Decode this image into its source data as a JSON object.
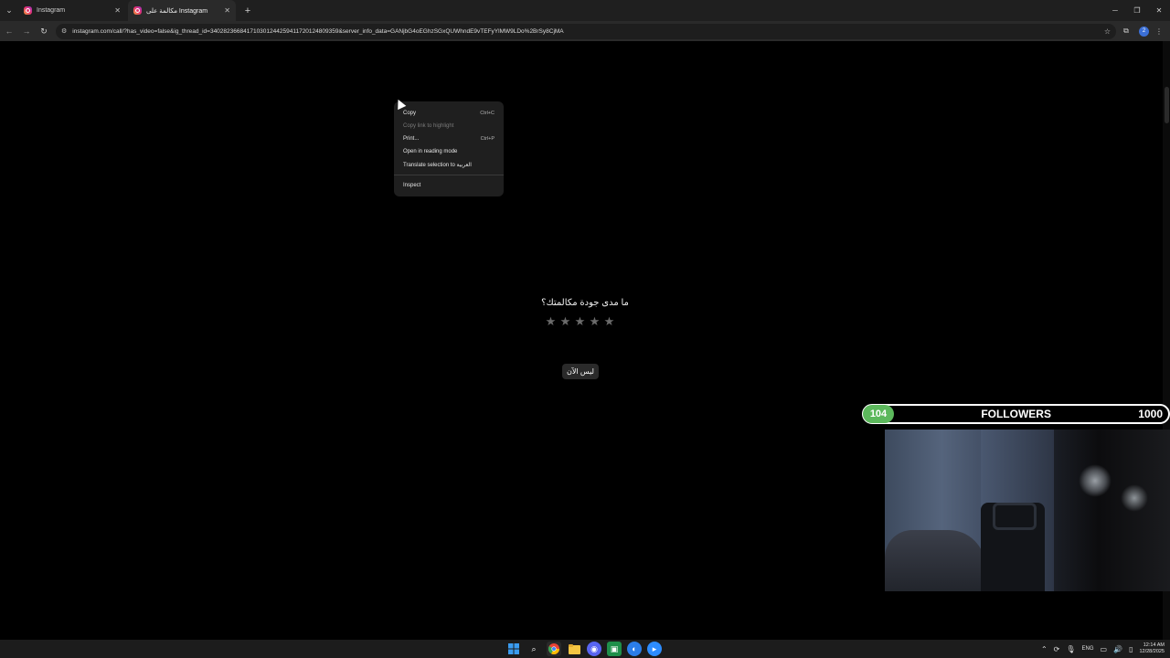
{
  "browser": {
    "tabs": [
      {
        "title": "Instagram",
        "active": false
      },
      {
        "title": "مكالمة على Instagram",
        "active": true
      }
    ],
    "url": "instagram.com/call/?has_video=false&ig_thread_id=340282366841710301244259411720124809359&server_info_data=GANjbG4oEGhzSGxQUWhndE9vTEFyYlMW9LDo%2BrSy8CjMA",
    "profile_count": "2"
  },
  "context_menu": {
    "items": [
      {
        "label": "Copy",
        "shortcut": "Ctrl+C",
        "enabled": true
      },
      {
        "label": "Copy link to highlight",
        "shortcut": "",
        "enabled": false
      },
      {
        "label": "Print...",
        "shortcut": "Ctrl+P",
        "enabled": true
      },
      {
        "label": "Open in reading mode",
        "shortcut": "",
        "enabled": true
      },
      {
        "label": "Translate selection to العربية",
        "shortcut": "",
        "enabled": true
      },
      {
        "label": "Inspect",
        "shortcut": "",
        "enabled": true
      }
    ]
  },
  "rating": {
    "question": "ما مدى جودة مكالمتك؟",
    "star_count": 5,
    "not_now_label": "ليس الآن"
  },
  "overlay": {
    "followers_count": "104",
    "followers_label": "FOLLOWERS",
    "followers_goal": "1000"
  },
  "taskbar": {
    "language": "ENG",
    "time": "12:14 AM",
    "date": "12/28/2025"
  },
  "colors": {
    "page_bg": "#000000",
    "followers_green": "#5cb85c",
    "star_gray": "#6b6b6b"
  }
}
